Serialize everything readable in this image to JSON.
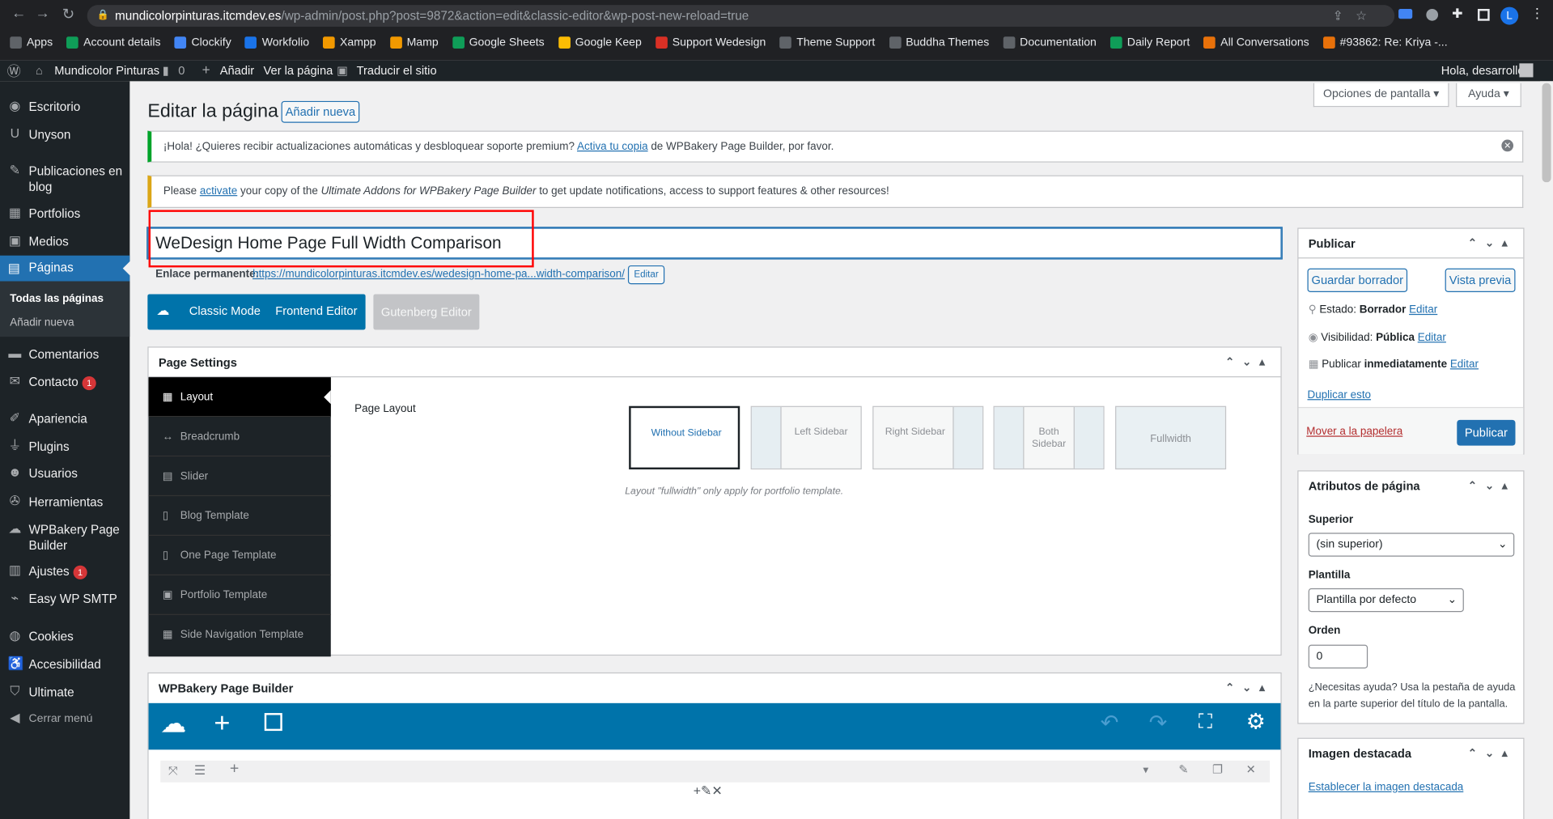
{
  "browser": {
    "url_host": "mundicolorpinturas.itcmdev.es",
    "url_path": "/wp-admin/post.php?post=9872&action=edit&classic-editor&wp-post-new-reload=true",
    "profile_initial": "L",
    "bookmarks": [
      "Apps",
      "Account details",
      "Clockify",
      "Workfolio",
      "Xampp",
      "Mamp",
      "Google Sheets",
      "Google Keep",
      "Support Wedesign",
      "Theme Support",
      "Buddha Themes",
      "Documentation",
      "Daily Report",
      "All Conversations",
      "#93862: Re: Kriya -..."
    ]
  },
  "adminbar": {
    "site": "Mundicolor Pinturas",
    "comments": "0",
    "add": "Añadir",
    "view": "Ver la página",
    "translate": "Traducir el sitio",
    "greeting": "Hola, desarrollo"
  },
  "sidebar": {
    "items": [
      "Escritorio",
      "Unyson",
      "Publicaciones en blog",
      "Portfolios",
      "Medios",
      "Páginas",
      "Comentarios",
      "Contacto",
      "Apariencia",
      "Plugins",
      "Usuarios",
      "Herramientas",
      "WPBakery Page Builder",
      "Ajustes",
      "Easy WP SMTP",
      "Cookies",
      "Accesibilidad",
      "Ultimate",
      "Cerrar menú"
    ],
    "submenu": [
      "Todas las páginas",
      "Añadir nueva"
    ],
    "contacto_badge": "1",
    "ajustes_badge": "1"
  },
  "screen": {
    "options": "Opciones de pantalla ▾",
    "help": "Ayuda ▾"
  },
  "page": {
    "title": "Editar la página",
    "add_new": "Añadir nueva"
  },
  "notices": {
    "n1_pre": "¡Hola! ¿Quieres recibir actualizaciones automáticas y desbloquear soporte premium?",
    "n1_link": "Activa tu copia",
    "n1_post": "de WPBakery Page Builder, por favor.",
    "n2_pre": "Please",
    "n2_link": "activate",
    "n2_mid": "your copy of the",
    "n2_em": "Ultimate Addons for WPBakery Page Builder",
    "n2_post": "to get update notifications, access to support features & other resources!"
  },
  "editor": {
    "post_title": "WeDesign Home Page Full Width Comparison",
    "permalink_label": "Enlace permanente:",
    "permalink_url": "https://mundicolorpinturas.itcmdev.es/wedesign-home-pa...width-comparison/",
    "permalink_edit": "Editar",
    "classic_mode": "Classic Mode",
    "frontend_editor": "Frontend Editor",
    "gutenberg_editor": "Gutenberg Editor"
  },
  "page_settings": {
    "title": "Page Settings",
    "tabs": [
      "Layout",
      "Breadcrumb",
      "Slider",
      "Blog Template",
      "One Page Template",
      "Portfolio Template",
      "Side Navigation Template"
    ],
    "page_layout_label": "Page Layout",
    "options": [
      "Without Sidebar",
      "Left Sidebar",
      "Right Sidebar",
      "Both Sidebar",
      "Fullwidth"
    ],
    "selected": "Without Sidebar",
    "note": "Layout \"fullwidth\" only apply for portfolio template."
  },
  "wpbakery": {
    "title": "WPBakery Page Builder"
  },
  "publish": {
    "title": "Publicar",
    "save_draft": "Guardar borrador",
    "preview": "Vista previa",
    "status_label": "Estado:",
    "status_value": "Borrador",
    "visibility_label": "Visibilidad:",
    "visibility_value": "Pública",
    "publish_label": "Publicar",
    "publish_value": "inmediatamente",
    "edit": "Editar",
    "duplicate": "Duplicar esto",
    "trash": "Mover a la papelera",
    "publish_btn": "Publicar"
  },
  "attributes": {
    "title": "Atributos de página",
    "parent_label": "Superior",
    "parent_value": "(sin superior)",
    "template_label": "Plantilla",
    "template_value": "Plantilla por defecto",
    "order_label": "Orden",
    "order_value": "0",
    "help": "¿Necesitas ayuda? Usa la pestaña de ayuda en la parte superior del título de la pantalla."
  },
  "featured": {
    "title": "Imagen destacada",
    "link": "Establecer la imagen destacada"
  },
  "colors": {
    "wp_blue": "#2271b1",
    "vc_blue": "#0073aa",
    "admin_dark": "#1d2327",
    "highlight": "#ff0000"
  }
}
